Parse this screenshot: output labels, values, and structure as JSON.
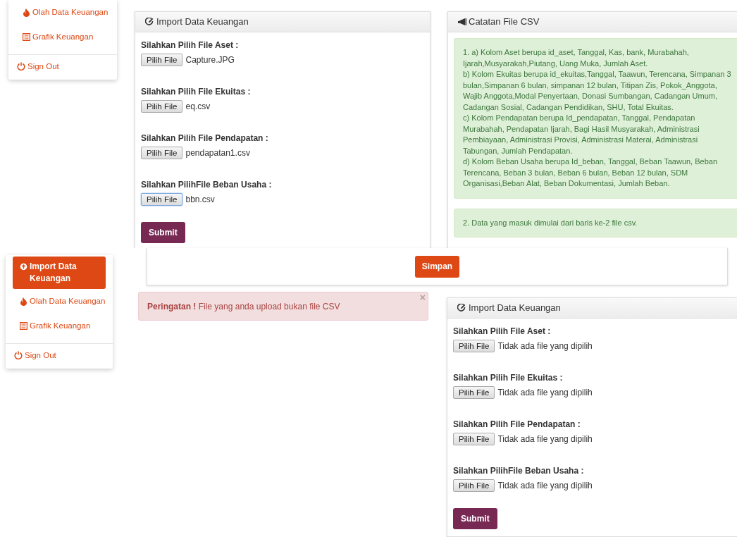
{
  "top_view": {
    "sidebar": {
      "items": [
        {
          "kind": "process",
          "label": "Olah Data Keuangan",
          "selected": false
        },
        {
          "kind": "chart",
          "label": "Grafik Keuangan",
          "selected": false
        },
        {
          "kind": "signout",
          "label": "Sign Out",
          "selected": false
        }
      ]
    },
    "import_form": {
      "title": "Import Data Keuangan",
      "fields": [
        {
          "label": "Silahkan Pilih File Aset :",
          "button": "Pilih File",
          "value": "Capture.JPG",
          "focused": false
        },
        {
          "label": "Silahkan Pilih File Ekuitas :",
          "button": "Pilih File",
          "value": "eq.csv",
          "focused": false
        },
        {
          "label": "Silahkan Pilih File Pendapatan :",
          "button": "Pilih File",
          "value": "pendapatan1.csv",
          "focused": false
        },
        {
          "label": "Silahkan PilihFile Beban Usaha :",
          "button": "Pilih File",
          "value": "bbn.csv",
          "focused": true
        }
      ],
      "submit": "Submit"
    },
    "notes": {
      "title": "Catatan File CSV",
      "boxes": [
        {
          "lines": [
            "1. a) Kolom Aset berupa id_aset, Tanggal, Kas, bank, Murabahah, Ijarah,Musyarakah,Piutang, Uang Muka, Jumlah Aset.",
            "b) Kolom Ekuitas berupa id_ekuitas,Tanggal, Taawun, Terencana, Simpanan 3 bulan,Simpanan 6 bulan, simpanan 12 bulan, Titipan Zis, Pokok_Anggota, Wajib Anggota,Modal Penyertaan, Donasi Sumbangan, Cadangan Umum, Cadangan Sosial, Cadangan Pendidikan, SHU, Total Ekuitas.",
            "c) Kolom Pendapatan berupa Id_pendapatan, Tanggal, Pendapatan Murabahah, Pendapatan Ijarah, Bagi Hasil Musyarakah, Administrasi Pembiayaan, Administrasi Provisi, Administrasi Materai, Administrasi Tabungan, Jumlah Pendapatan.",
            "d) Kolom Beban Usaha berupa Id_beban, Tanggal, Beban Taawun, Beban Terencana, Beban 3 bulan, Beban 6 bulan, Beban 12 bulan, SDM Organisasi,Beban Alat, Beban Dokumentasi, Jumlah Beban."
          ]
        },
        {
          "lines": [
            "2. Data yang masuk dimulai dari baris ke-2 file csv."
          ]
        }
      ]
    }
  },
  "bottom_view": {
    "sidebar": {
      "items": [
        {
          "kind": "import",
          "label": "Import Data Keuangan",
          "selected": true
        },
        {
          "kind": "process",
          "label": "Olah Data Keuangan",
          "selected": false
        },
        {
          "kind": "chart",
          "label": "Grafik Keuangan",
          "selected": false
        },
        {
          "kind": "signout",
          "label": "Sign Out",
          "selected": false
        }
      ]
    },
    "save_button": "Simpan",
    "alert": {
      "text": "**Peringatan !** File yang anda upload bukan file CSV",
      "close": "×"
    },
    "import_form": {
      "title": "Import Data Keuangan",
      "fields": [
        {
          "label": "Silahkan Pilih File Aset :",
          "button": "Pilih File",
          "value": "Tidak ada file yang dipilih",
          "focused": false
        },
        {
          "label": "Silahkan Pilih File Ekuitas :",
          "button": "Pilih File",
          "value": "Tidak ada file yang dipilih",
          "focused": false
        },
        {
          "label": "Silahkan Pilih File Pendapatan :",
          "button": "Pilih File",
          "value": "Tidak ada file yang dipilih",
          "focused": false
        },
        {
          "label": "Silahkan PilihFile Beban Usaha :",
          "button": "Pilih File",
          "value": "Tidak ada file yang dipilih",
          "focused": false
        }
      ],
      "submit": "Submit"
    }
  }
}
